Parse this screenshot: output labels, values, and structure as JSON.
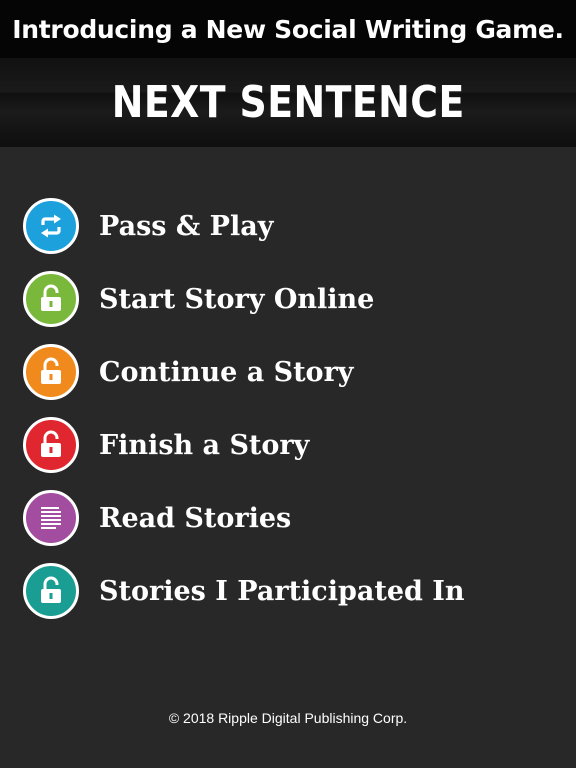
{
  "banner": {
    "text": "Introducing a New Social Writing Game."
  },
  "header": {
    "title": "NEXT SENTENCE"
  },
  "menu": {
    "items": [
      {
        "label": "Pass & Play",
        "icon": "refresh-icon",
        "color": "#1da1dd"
      },
      {
        "label": "Start Story Online",
        "icon": "unlock-icon",
        "color": "#7ab83c"
      },
      {
        "label": "Continue a Story",
        "icon": "unlock-icon",
        "color": "#f08a1d"
      },
      {
        "label": "Finish a Story",
        "icon": "unlock-icon",
        "color": "#e0262e"
      },
      {
        "label": "Read Stories",
        "icon": "document-lines-icon",
        "color": "#a24d9f"
      },
      {
        "label": "Stories I Participated In",
        "icon": "unlock-icon",
        "color": "#1a9e94"
      }
    ]
  },
  "footer": {
    "copyright": "© 2018 Ripple Digital Publishing Corp."
  }
}
